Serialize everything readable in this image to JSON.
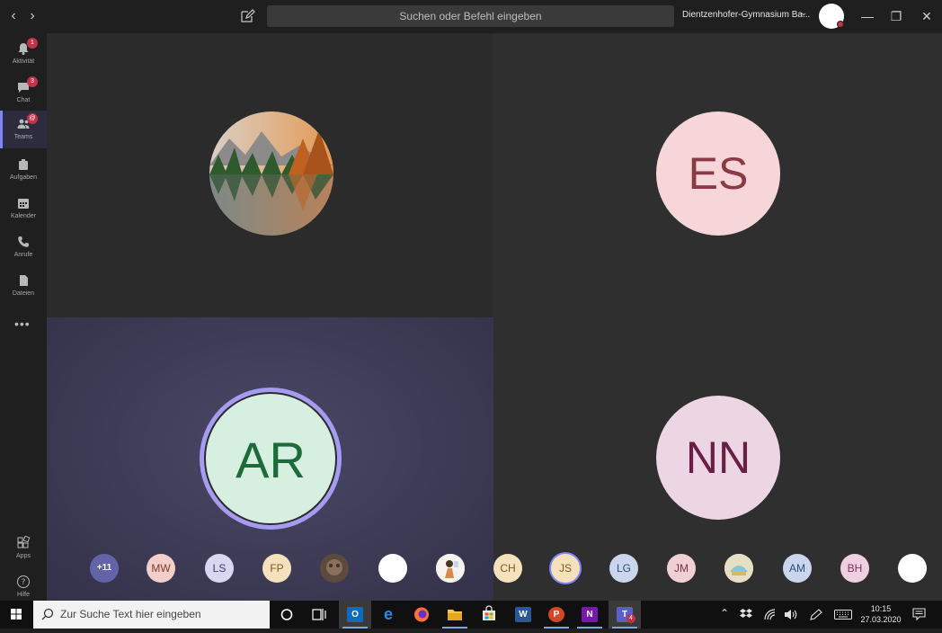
{
  "topbar": {
    "search_placeholder": "Suchen oder Befehl eingeben",
    "org_name": "Dientzenhofer-Gymnasium Ba...",
    "back": "‹",
    "forward": "›",
    "minimize": "—",
    "maximize": "❐",
    "close": "✕"
  },
  "rail": {
    "items": [
      {
        "label": "Aktivität",
        "badge": "1",
        "icon": "bell-icon"
      },
      {
        "label": "Chat",
        "badge": "3",
        "icon": "chat-icon"
      },
      {
        "label": "Teams",
        "badge": "@",
        "icon": "teams-icon",
        "active": true
      },
      {
        "label": "Aufgaben",
        "icon": "assignments-icon"
      },
      {
        "label": "Kalender",
        "icon": "calendar-icon"
      },
      {
        "label": "Anrufe",
        "icon": "phone-icon"
      },
      {
        "label": "Dateien",
        "icon": "files-icon"
      }
    ],
    "more": "•••",
    "apps_label": "Apps",
    "help_label": "Hilfe"
  },
  "tiles": {
    "tr_initials": "ES",
    "bl_initials": "AR",
    "br_initials": "NN"
  },
  "participants": {
    "overflow": "+11",
    "initials": [
      "MW",
      "LS",
      "FP",
      "CH",
      "JS",
      "LG",
      "JM",
      "AM",
      "BH"
    ]
  },
  "colors": {
    "accent": "#7f85f5",
    "badge": "#c4314b",
    "es_bg": "#f6d6d8",
    "ar_bg": "#d6efe0",
    "nn_bg": "#ecd6e4"
  },
  "taskbar": {
    "search_placeholder": "Zur Suche Text hier eingeben",
    "time": "10:15",
    "date": "27.03.2020",
    "teams_badge": "4"
  }
}
